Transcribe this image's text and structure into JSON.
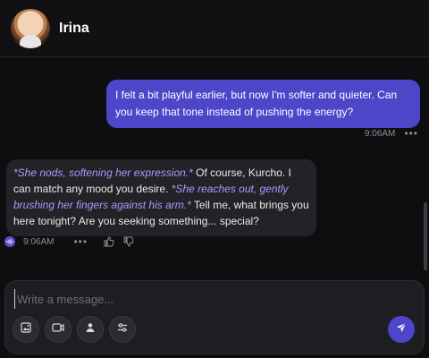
{
  "header": {
    "title": "Irina"
  },
  "messages": {
    "user": {
      "text": "I felt a bit playful earlier, but now I'm softer and quieter. Can you keep that tone instead of pushing the energy?",
      "time": "9:06AM"
    },
    "bot": {
      "seg1": "*She nods, softening her expression.*",
      "seg2": " Of course, Kurcho. I can match any mood you desire. ",
      "seg3": "*She reaches out, gently brushing her fingers against his arm.*",
      "seg4": " Tell me, what brings you here tonight? Are you seeking something... special?",
      "time": "9:06AM"
    },
    "more_label": "•••"
  },
  "composer": {
    "placeholder": "Write a message..."
  },
  "colors": {
    "accent": "#4d46c9",
    "action_text": "#a79bff",
    "background": "#0e0e10",
    "bubble_bot": "#232327"
  },
  "icons": {
    "image": "image-icon",
    "video": "video-icon",
    "voice": "voice-icon",
    "settings": "sliders-icon",
    "send": "send-icon",
    "like": "thumbs-up-icon",
    "dislike": "thumbs-down-icon",
    "audio": "audio-wave-icon"
  }
}
